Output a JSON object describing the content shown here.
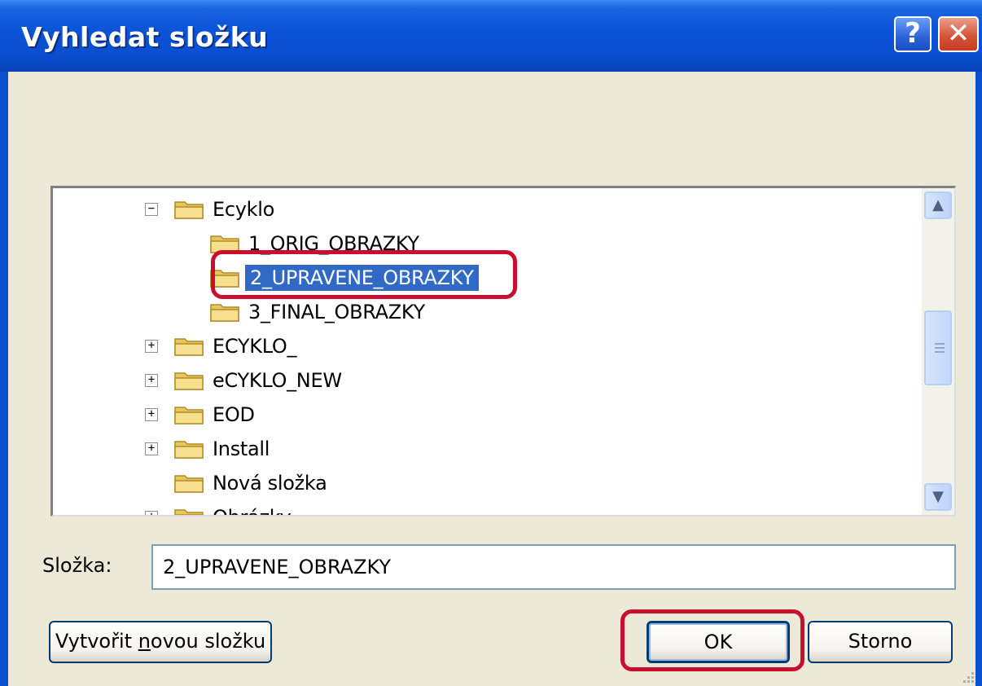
{
  "window": {
    "title": "Vyhledat složku"
  },
  "titlebar": {
    "help_label": "?",
    "close_label": "✕"
  },
  "tree": {
    "items": [
      {
        "label": "Ecyklo",
        "expander": "−"
      },
      {
        "label": "1_ORIG_OBRAZKY",
        "expander": ""
      },
      {
        "label": "2_UPRAVENE_OBRAZKY",
        "expander": "",
        "selected": true
      },
      {
        "label": "3_FINAL_OBRAZKY",
        "expander": ""
      },
      {
        "label": "ECYKLO_",
        "expander": "+"
      },
      {
        "label": "eCYKLO_NEW",
        "expander": "+"
      },
      {
        "label": "EOD",
        "expander": "+"
      },
      {
        "label": "Install",
        "expander": "+"
      },
      {
        "label": "Nová složka",
        "expander": ""
      },
      {
        "label": "Obrázky",
        "expander": "+"
      }
    ]
  },
  "scrollbar": {
    "up_icon": "▲",
    "down_icon": "▼"
  },
  "folder_field": {
    "label": "Složka:",
    "value": "2_UPRAVENE_OBRAZKY"
  },
  "buttons": {
    "new_folder_pre": "Vytvořit ",
    "new_folder_underline": "n",
    "new_folder_post": "ovou složku",
    "ok": "OK",
    "cancel": "Storno"
  },
  "colors": {
    "titlebar": "#0a52d7",
    "selection": "#316ac5",
    "highlight_ring": "#c8102e",
    "dialog_bg": "#ece9d8"
  }
}
